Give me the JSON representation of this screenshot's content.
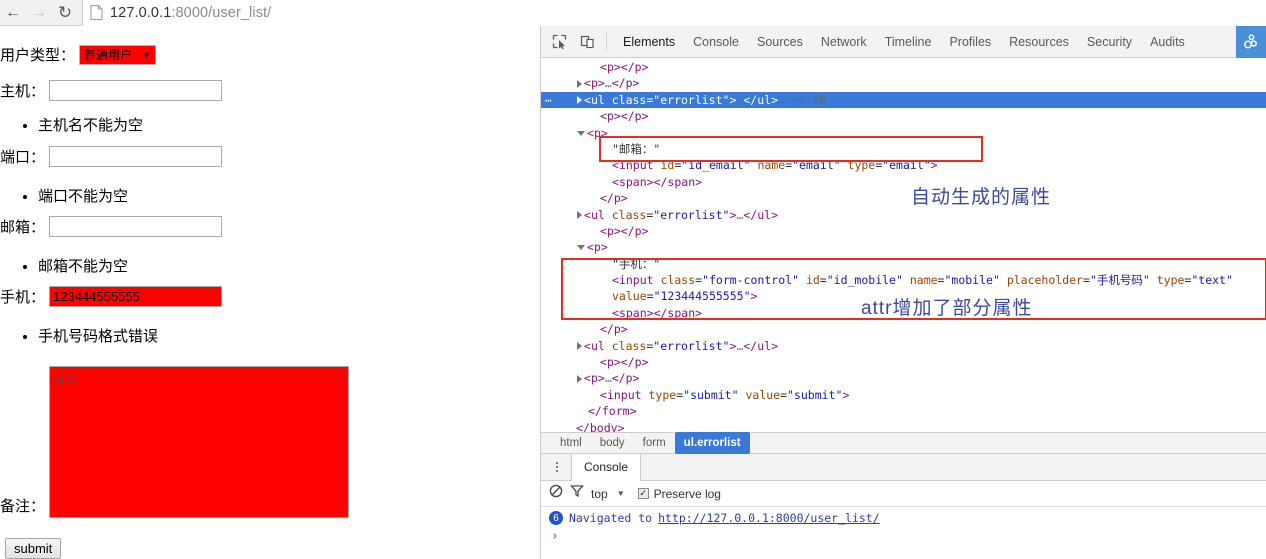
{
  "browser": {
    "back_icon": "back-arrow-icon",
    "forward_icon": "forward-arrow-icon",
    "reload_icon": "reload-icon",
    "url": "127.0.0.1:8000/user_list/",
    "url_host": "127.0.0.1",
    "url_path": ":8000/user_list/"
  },
  "page": {
    "fields": {
      "usertype_label": "用户类型：",
      "usertype_value": "普通用户",
      "host_label": "主机：",
      "host_value": "",
      "port_label": "端口：",
      "port_value": "",
      "email_label": "邮箱：",
      "email_value": "",
      "mobile_label": "手机：",
      "mobile_value": "123444555555",
      "remark_label": "备注：",
      "remark_placeholder": "备注"
    },
    "errors": {
      "host": "主机名不能为空",
      "port": "端口不能为空",
      "email": "邮箱不能为空",
      "mobile": "手机号码格式错误"
    },
    "submit_label": "submit",
    "error_color": "#ff0000"
  },
  "devtools": {
    "inspect_icon": "inspect-element-icon",
    "device_icon": "device-toolbar-icon",
    "extension_icon": "extension-icon",
    "tabs": [
      "Elements",
      "Console",
      "Sources",
      "Network",
      "Timeline",
      "Profiles",
      "Resources",
      "Security",
      "Audits"
    ],
    "active_tab": "Elements",
    "breadcrumb": [
      "html",
      "body",
      "form",
      "ul.errorlist"
    ],
    "breadcrumb_active": "ul.errorlist",
    "selected_color": "#3879d9",
    "annotations": [
      {
        "text": "自动生成的属性"
      },
      {
        "text": "attr增加了部分属性"
      }
    ],
    "dom_lines": [
      {
        "indent": 4,
        "tri": "",
        "html": "<span class='punc'>&lt;</span><span class='tag'>p</span><span class='punc'>&gt;&lt;/</span><span class='tag'>p</span><span class='punc'>&gt;</span>"
      },
      {
        "indent": 3,
        "tri": "closed",
        "html": "<span class='punc'>&lt;</span><span class='tag'>p</span><span class='punc'>&gt;</span><span class='ell'>…</span><span class='punc'>&lt;/</span><span class='tag'>p</span><span class='punc'>&gt;</span>"
      },
      {
        "indent": 3,
        "tri": "closed",
        "sel": true,
        "html": "<span class='punc'>&lt;</span><span class='tag'>ul</span> <span class='attr'>class</span>=<span class='val'>\"errorlist\"</span><span class='punc'>&gt;</span><span class='ell'>…</span><span class='punc'>&lt;/</span><span class='tag'>ul</span><span class='punc'>&gt;</span>  <span class='dollar'>== $0</span>"
      },
      {
        "indent": 4,
        "tri": "",
        "html": "<span class='punc'>&lt;</span><span class='tag'>p</span><span class='punc'>&gt;&lt;/</span><span class='tag'>p</span><span class='punc'>&gt;</span>"
      },
      {
        "indent": 3,
        "tri": "open",
        "html": "<span class='punc'>&lt;</span><span class='tag'>p</span><span class='punc'>&gt;</span>"
      },
      {
        "indent": 5,
        "tri": "",
        "html": "<span class='txt'>\"邮箱：\"</span>"
      },
      {
        "indent": 5,
        "tri": "",
        "html": "<span class='punc'>&lt;</span><span class='tag'>input</span> <span class='attr'>id</span>=<span class='val'>\"id_email\"</span> <span class='attr'>name</span>=<span class='val'>\"email\"</span> <span class='attr'>type</span>=<span class='val'>\"email\"</span><span class='punc'>&gt;</span>"
      },
      {
        "indent": 5,
        "tri": "",
        "html": "<span class='punc'>&lt;</span><span class='tag'>span</span><span class='punc'>&gt;&lt;/</span><span class='tag'>span</span><span class='punc'>&gt;</span>"
      },
      {
        "indent": 4,
        "tri": "",
        "html": "<span class='punc'>&lt;/</span><span class='tag'>p</span><span class='punc'>&gt;</span>"
      },
      {
        "indent": 3,
        "tri": "closed",
        "html": "<span class='punc'>&lt;</span><span class='tag'>ul</span> <span class='attr'>class</span>=<span class='val'>\"errorlist\"</span><span class='punc'>&gt;</span><span class='ell'>…</span><span class='punc'>&lt;/</span><span class='tag'>ul</span><span class='punc'>&gt;</span>"
      },
      {
        "indent": 4,
        "tri": "",
        "html": "<span class='punc'>&lt;</span><span class='tag'>p</span><span class='punc'>&gt;&lt;/</span><span class='tag'>p</span><span class='punc'>&gt;</span>"
      },
      {
        "indent": 3,
        "tri": "open",
        "html": "<span class='punc'>&lt;</span><span class='tag'>p</span><span class='punc'>&gt;</span>"
      },
      {
        "indent": 5,
        "tri": "",
        "html": "<span class='txt'>\"手机：\"</span>"
      },
      {
        "indent": 5,
        "tri": "",
        "html": "<span class='punc'>&lt;</span><span class='tag'>input</span> <span class='attr'>class</span>=<span class='val'>\"form-control\"</span> <span class='attr'>id</span>=<span class='val'>\"id_mobile\"</span> <span class='attr'>name</span>=<span class='val'>\"mobile\"</span> <span class='attr'>placeholder</span>=<span class='val'>\"手机号码\"</span> <span class='attr'>type</span>=<span class='val'>\"text\"</span>"
      },
      {
        "indent": 5,
        "tri": "",
        "html": "<span class='attr'>value</span>=<span class='val'>\"123444555555\"</span><span class='punc'>&gt;</span>"
      },
      {
        "indent": 5,
        "tri": "",
        "html": "<span class='punc'>&lt;</span><span class='tag'>span</span><span class='punc'>&gt;&lt;/</span><span class='tag'>span</span><span class='punc'>&gt;</span>"
      },
      {
        "indent": 4,
        "tri": "",
        "html": "<span class='punc'>&lt;/</span><span class='tag'>p</span><span class='punc'>&gt;</span>"
      },
      {
        "indent": 3,
        "tri": "closed",
        "html": "<span class='punc'>&lt;</span><span class='tag'>ul</span> <span class='attr'>class</span>=<span class='val'>\"errorlist\"</span><span class='punc'>&gt;</span><span class='ell'>…</span><span class='punc'>&lt;/</span><span class='tag'>ul</span><span class='punc'>&gt;</span>"
      },
      {
        "indent": 4,
        "tri": "",
        "html": "<span class='punc'>&lt;</span><span class='tag'>p</span><span class='punc'>&gt;&lt;/</span><span class='tag'>p</span><span class='punc'>&gt;</span>"
      },
      {
        "indent": 3,
        "tri": "closed",
        "html": "<span class='punc'>&lt;</span><span class='tag'>p</span><span class='punc'>&gt;</span><span class='ell'>…</span><span class='punc'>&lt;/</span><span class='tag'>p</span><span class='punc'>&gt;</span>"
      },
      {
        "indent": 4,
        "tri": "",
        "html": "<span class='punc'>&lt;</span><span class='tag'>input</span> <span class='attr'>type</span>=<span class='val'>\"submit\"</span> <span class='attr'>value</span>=<span class='val'>\"submit\"</span><span class='punc'>&gt;</span>"
      },
      {
        "indent": 3,
        "tri": "",
        "html": "<span class='punc'>&lt;/</span><span class='tag'>form</span><span class='punc'>&gt;</span>"
      },
      {
        "indent": 2,
        "tri": "",
        "html": "<span class='punc'>&lt;/</span><span class='tag'>body</span><span class='punc'>&gt;</span>"
      }
    ]
  },
  "console": {
    "drawer_tab": "Console",
    "clear_icon": "clear-console-icon",
    "filter_icon": "filter-icon",
    "context": "top",
    "preserve_log_label": "Preserve log",
    "preserve_log_checked": true,
    "message_count": "6",
    "message_text": "Navigated to",
    "message_link": "http://127.0.0.1:8000/user_list/",
    "prompt": "›"
  }
}
